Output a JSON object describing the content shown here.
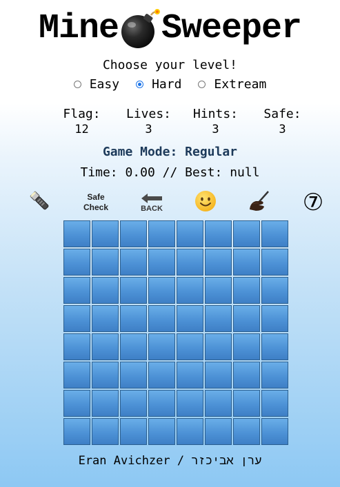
{
  "title": {
    "left": "Mine",
    "right": "Sweeper",
    "icon": "bomb-icon"
  },
  "choose_label": "Choose your level!",
  "levels": [
    {
      "label": "Easy",
      "checked": false
    },
    {
      "label": "Hard",
      "checked": true
    },
    {
      "label": "Extream",
      "checked": false
    }
  ],
  "stats": [
    {
      "label": "Flag:",
      "value": "12"
    },
    {
      "label": "Lives:",
      "value": "3"
    },
    {
      "label": "Hints:",
      "value": "3"
    },
    {
      "label": "Safe:",
      "value": "3"
    }
  ],
  "mode_text": "Game Mode: Regular",
  "time_text": "Time: 0.00 // Best: null",
  "toolbar": {
    "hint_icon": "flashlight-icon",
    "safe_check_line1": "Safe",
    "safe_check_line2": "Check",
    "back_label": "BACK",
    "smiley_icon": "smiley-icon",
    "manual_icon": "writing-hand-icon",
    "seven_boom": "⑦"
  },
  "board": {
    "rows": 8,
    "cols": 8,
    "cell_color": "#4d92d6"
  },
  "footer": "Eran Avichzer / ערן אביכזר"
}
